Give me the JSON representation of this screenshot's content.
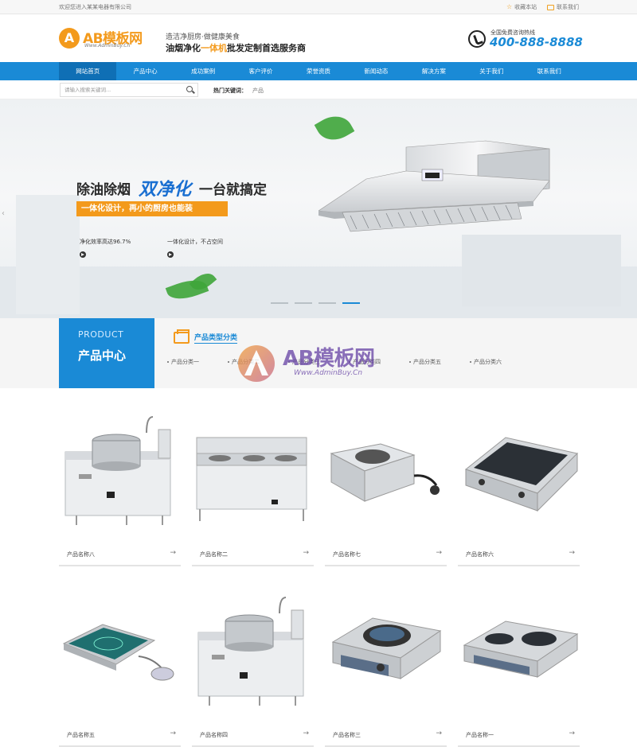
{
  "topbar": {
    "welcome": "欢迎您进入某某电器有限公司",
    "bookmark": "收藏本站",
    "contact": "联系我们"
  },
  "header": {
    "logo_letter": "A",
    "logo_text": "AB模板网",
    "logo_url": "Www.AdminBuy.Cn",
    "slogan_top": "造洁净厨房·做健康美食",
    "slogan_a": "油烟净化",
    "slogan_hl": "一体机",
    "slogan_b": "批发定制首选服务商",
    "hotline_label": "全国免费咨询热线",
    "hotline_number": "400-888-8888"
  },
  "nav": {
    "items": [
      "网站首页",
      "产品中心",
      "成功案例",
      "客户评价",
      "荣誉资质",
      "新闻动态",
      "解决方案",
      "关于我们",
      "联系我们"
    ]
  },
  "search": {
    "placeholder": "请输入搜索关键词...",
    "hot_label": "热门关键词：",
    "hot_keyword": "产品"
  },
  "banner": {
    "h1_a": "除油除烟",
    "h1_script": "双净化",
    "h1_b": "一台就搞定",
    "tag": "一体化设计，再小的厨房也能装",
    "feature1": "净化效率高达96.7%",
    "feature2": "一体化设计，不占空间"
  },
  "category": {
    "en": "PRODUCT",
    "zh": "产品中心",
    "title": "产品类型分类",
    "items": [
      "产品分类一",
      "产品分类二",
      "产品分类三",
      "产品分类四",
      "产品分类五",
      "产品分类六"
    ]
  },
  "watermark": {
    "text": "AB模板网",
    "url": "Www.AdminBuy.Cn"
  },
  "products": [
    {
      "name": "产品名称八",
      "icon": "soup-boiler-image"
    },
    {
      "name": "产品名称二",
      "icon": "wok-range-image"
    },
    {
      "name": "产品名称七",
      "icon": "induction-wok-image"
    },
    {
      "name": "产品名称六",
      "icon": "induction-cooker-image"
    },
    {
      "name": "产品名称五",
      "icon": "induction-plate-image"
    },
    {
      "name": "产品名称四",
      "icon": "soup-boiler-image"
    },
    {
      "name": "产品名称三",
      "icon": "induction-wok-image"
    },
    {
      "name": "产品名称一",
      "icon": "induction-cooker-image"
    }
  ],
  "colors": {
    "accent": "#1a8ad6",
    "brand_orange": "#f39a1c"
  }
}
